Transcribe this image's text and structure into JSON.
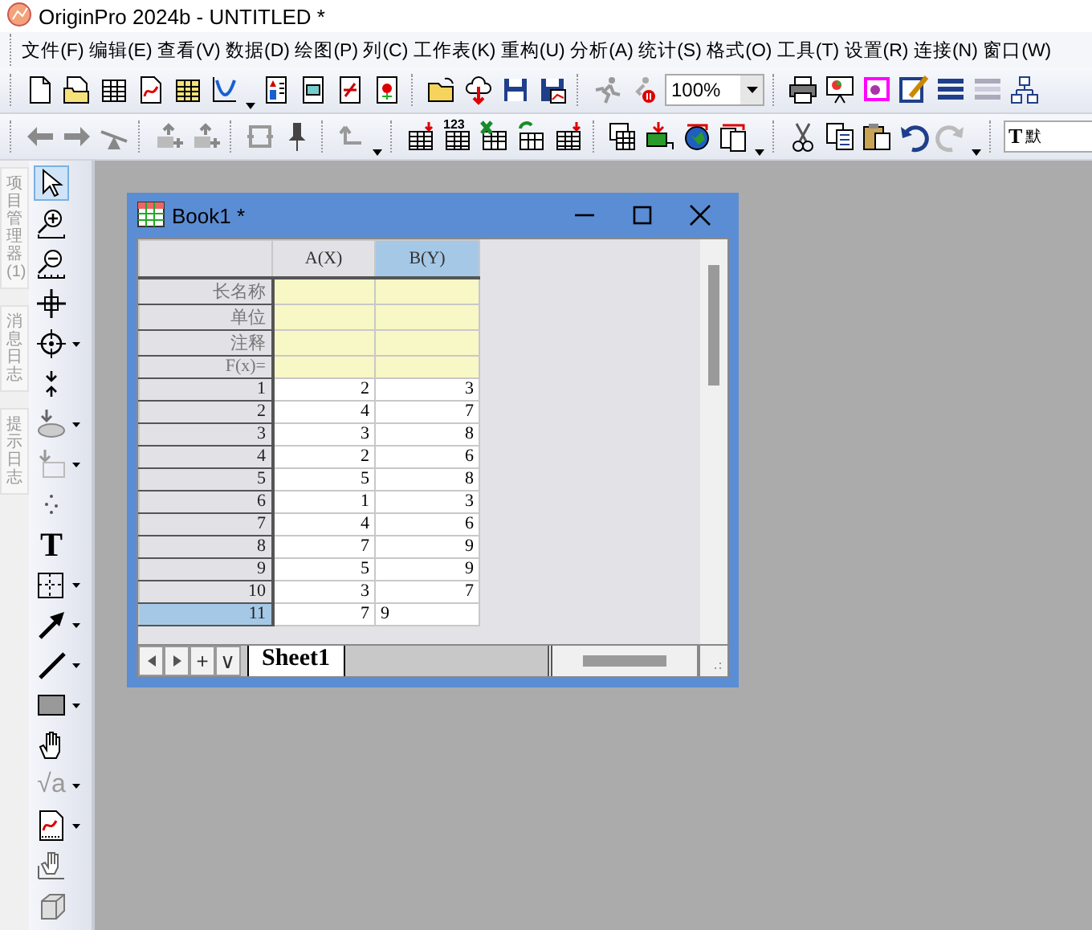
{
  "window": {
    "title": "OriginPro 2024b - UNTITLED *"
  },
  "menu": [
    "文件(F)",
    "编辑(E)",
    "查看(V)",
    "数据(D)",
    "绘图(P)",
    "列(C)",
    "工作表(K)",
    "重构(U)",
    "分析(A)",
    "统计(S)",
    "格式(O)",
    "工具(T)",
    "设置(R)",
    "连接(N)",
    "窗口(W)"
  ],
  "toolbar": {
    "zoom": "100%",
    "numeric_badge": "123",
    "font_icon": "T",
    "font_field": "默"
  },
  "side_tabs": [
    "项目管理器 (1)",
    "消息日志",
    "提示日志"
  ],
  "tools": [
    {
      "kind": "pointer",
      "selected": true,
      "menu": false
    },
    {
      "kind": "zoom-in",
      "selected": false,
      "menu": false
    },
    {
      "kind": "zoom-out",
      "selected": false,
      "menu": false
    },
    {
      "kind": "crosshair",
      "selected": false,
      "menu": false
    },
    {
      "kind": "target",
      "selected": false,
      "menu": true
    },
    {
      "kind": "arrows",
      "selected": false,
      "menu": false
    },
    {
      "kind": "ellipse",
      "selected": false,
      "menu": true
    },
    {
      "kind": "frame-select",
      "selected": false,
      "menu": true
    },
    {
      "kind": "dots",
      "selected": false,
      "menu": false
    },
    {
      "kind": "text",
      "glyph": "T",
      "selected": false,
      "menu": false
    },
    {
      "kind": "frame",
      "selected": false,
      "menu": true
    },
    {
      "kind": "arrow",
      "selected": false,
      "menu": true
    },
    {
      "kind": "line",
      "selected": false,
      "menu": true
    },
    {
      "kind": "rectangle",
      "selected": false,
      "menu": true
    },
    {
      "kind": "hand",
      "selected": false,
      "menu": false
    },
    {
      "kind": "formula",
      "glyph": "√a",
      "selected": false,
      "menu": true
    },
    {
      "kind": "graph",
      "selected": false,
      "menu": true
    },
    {
      "kind": "hand-axis",
      "selected": false,
      "menu": false
    },
    {
      "kind": "cube",
      "selected": false,
      "menu": false
    }
  ],
  "book": {
    "title": "Book1 *",
    "columns": [
      {
        "label": "A(X)",
        "selected": false
      },
      {
        "label": "B(Y)",
        "selected": true
      }
    ],
    "label_rows": [
      "长名称",
      "单位",
      "注释",
      "F(x)="
    ],
    "rows": [
      {
        "header": "1",
        "cells": [
          "2",
          "3"
        ],
        "selected": false
      },
      {
        "header": "2",
        "cells": [
          "4",
          "7"
        ],
        "selected": false
      },
      {
        "header": "3",
        "cells": [
          "3",
          "8"
        ],
        "selected": false
      },
      {
        "header": "4",
        "cells": [
          "2",
          "6"
        ],
        "selected": false
      },
      {
        "header": "5",
        "cells": [
          "5",
          "8"
        ],
        "selected": false
      },
      {
        "header": "6",
        "cells": [
          "1",
          "3"
        ],
        "selected": false
      },
      {
        "header": "7",
        "cells": [
          "4",
          "6"
        ],
        "selected": false
      },
      {
        "header": "8",
        "cells": [
          "7",
          "9"
        ],
        "selected": false
      },
      {
        "header": "9",
        "cells": [
          "5",
          "9"
        ],
        "selected": false
      },
      {
        "header": "10",
        "cells": [
          "3",
          "7"
        ],
        "selected": false
      },
      {
        "header": "11",
        "cells": [
          "7"
        ],
        "selected": true
      }
    ],
    "editor": {
      "value": "9"
    },
    "sheet_buttons": [
      "+",
      "∨"
    ],
    "sheets": [
      {
        "label": "Sheet1",
        "selected": true
      }
    ]
  }
}
